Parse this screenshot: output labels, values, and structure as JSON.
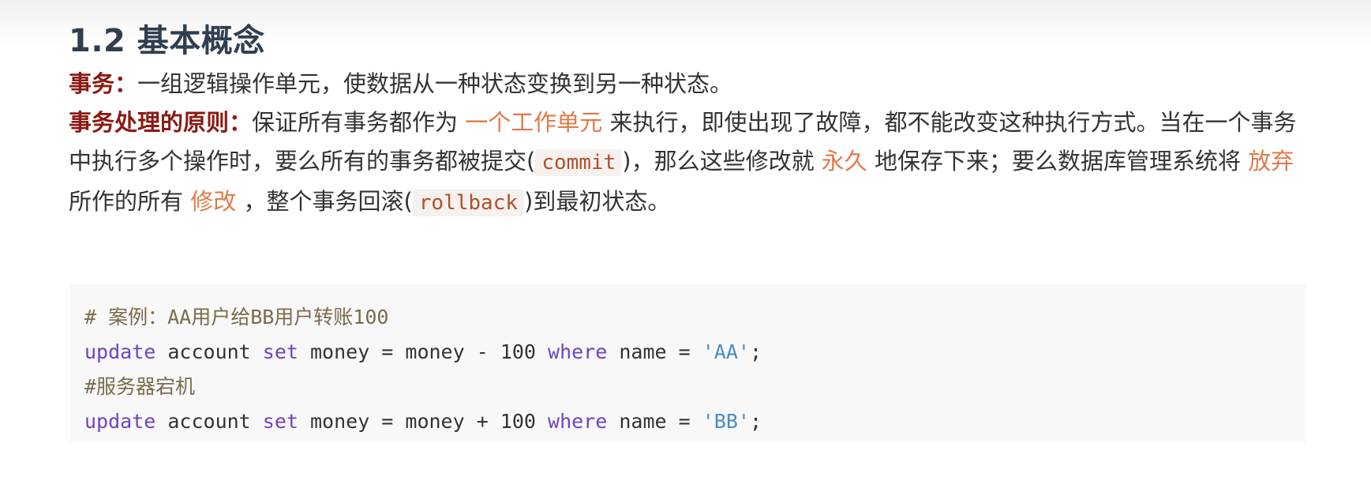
{
  "heading": "1.2 基本概念",
  "para1": {
    "term": "事务：",
    "text": "一组逻辑操作单元，使数据从一种状态变换到另一种状态。"
  },
  "para2": {
    "term": "事务处理的原则：",
    "t1": "保证所有事务都作为",
    "h1": " 一个工作单元 ",
    "t2": "来执行，即使出现了故障，都不能改变这种执行方式。当在一个事务中执行多个操作时，要么所有的事务都被提交(",
    "c1": "commit",
    "t3": ")，那么这些修改就",
    "h2": " 永久 ",
    "t4": "地保存下来；要么数据库管理系统将",
    "h3": " 放弃 ",
    "t5": "所作的所有",
    "h4": " 修改 ",
    "t6": "，整个事务回滚(",
    "c2": "rollback",
    "t7": ")到最初状态。"
  },
  "code": {
    "comment1": "# 案例：AA用户给BB用户转账100",
    "line1": {
      "kw1": "update",
      "t1": " account ",
      "kw2": "set",
      "t2": " money = money - ",
      "num": "100",
      "sp": " ",
      "kw3": "where",
      "t3": " name = ",
      "str": "'AA'",
      "end": ";"
    },
    "comment2": "#服务器宕机",
    "line2": {
      "kw1": "update",
      "t1": " account ",
      "kw2": "set",
      "t2": " money = money + ",
      "num": "100",
      "sp": " ",
      "kw3": "where",
      "t3": " name = ",
      "str": "'BB'",
      "end": ";"
    }
  }
}
